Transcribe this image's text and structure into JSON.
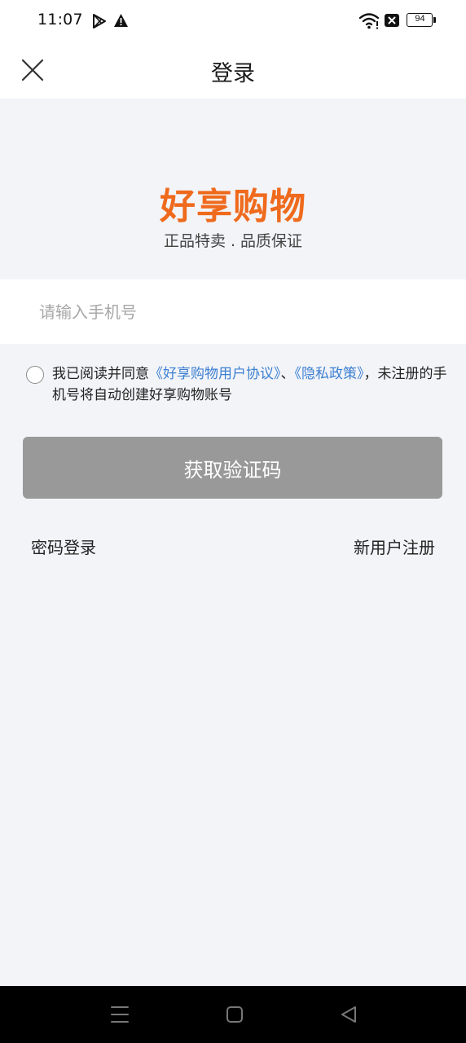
{
  "status_bar": {
    "time": "11:07",
    "battery": "94",
    "icons": [
      "play-store-icon",
      "warning-icon",
      "wifi-icon",
      "no-sim-icon",
      "battery-icon"
    ]
  },
  "nav": {
    "title": "登录",
    "close_icon": "close-icon"
  },
  "brand": {
    "name": "好享购物",
    "slogan": "正品特卖 . 品质保证",
    "color": "#ef6a1c"
  },
  "phone_input": {
    "placeholder": "请输入手机号",
    "value": ""
  },
  "agreement": {
    "prefix": "我已阅读并同意",
    "user_agreement": "《好享购物用户协议》",
    "separator": "、",
    "privacy_policy": "《隐私政策》",
    "suffix": "，未注册的手机号将自动创建好享购物账号",
    "checked": false,
    "link_color": "#3d7fd1"
  },
  "actions": {
    "get_code": "获取验证码",
    "password_login": "密码登录",
    "register": "新用户注册"
  },
  "system_nav": {
    "icons": [
      "menu-icon",
      "home-icon",
      "back-icon"
    ]
  }
}
